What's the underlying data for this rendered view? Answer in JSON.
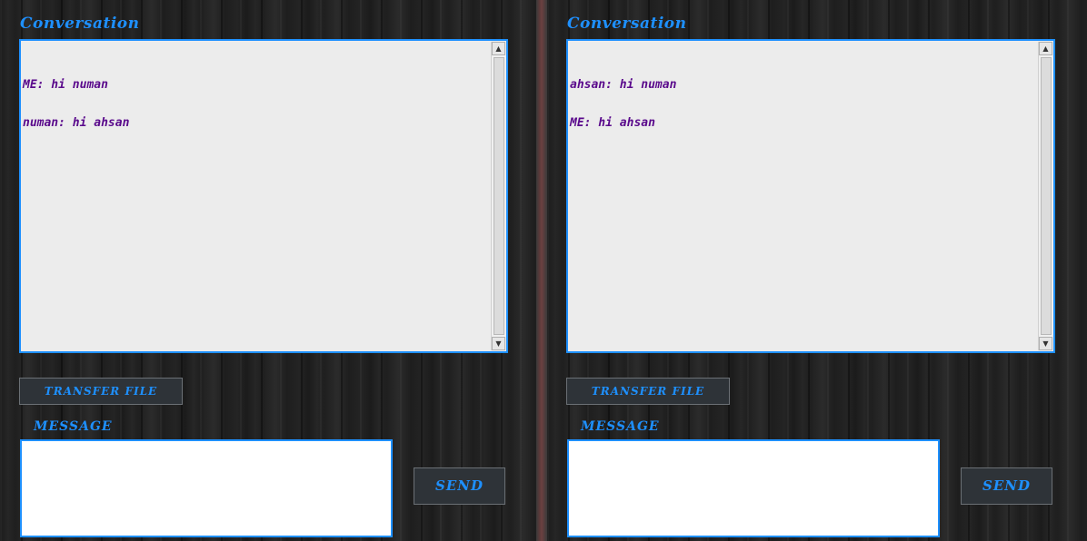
{
  "left": {
    "conversation_title": "Conversation",
    "messages": [
      "ME: hi numan",
      "numan: hi ahsan"
    ],
    "transfer_label": "TRANSFER FILE",
    "message_label": "MESSAGE",
    "message_value": "",
    "send_label": "SEND"
  },
  "right": {
    "conversation_title": "Conversation",
    "messages": [
      "ahsan: hi numan",
      "ME: hi ahsan"
    ],
    "transfer_label": "TRANSFER FILE",
    "message_label": "MESSAGE",
    "message_value": "",
    "send_label": "SEND"
  },
  "colors": {
    "accent": "#1e90ff",
    "chat_text": "#5a0a8c",
    "chat_bg": "#ececec",
    "button_bg": "#2e3338"
  },
  "icons": {
    "scroll_up": "arrow-up-icon",
    "scroll_down": "arrow-down-icon"
  }
}
